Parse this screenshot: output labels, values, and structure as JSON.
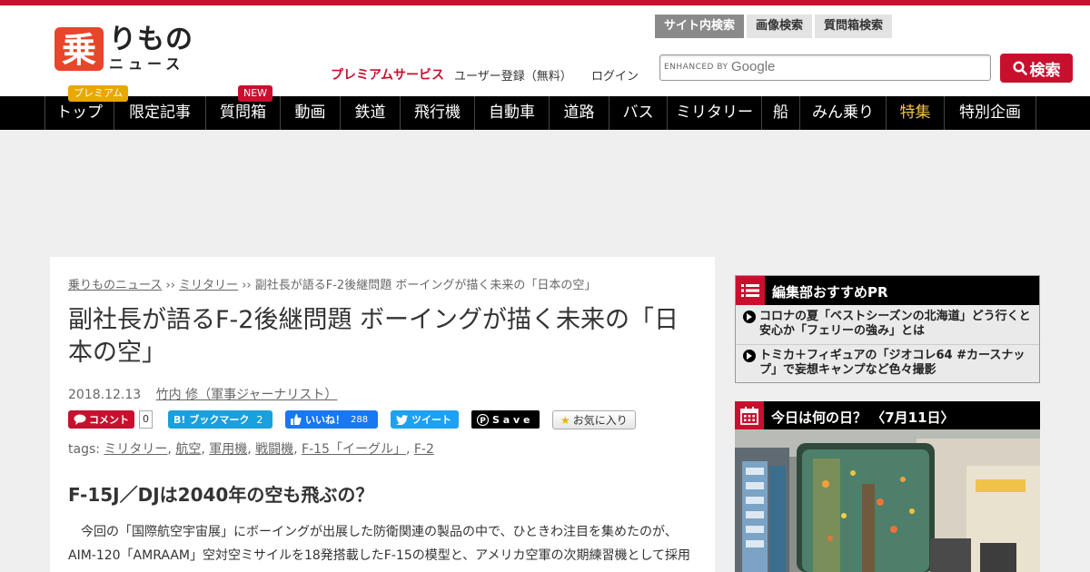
{
  "brand": {
    "colors": {
      "accent": "#c8102e",
      "nav_bg": "#000000",
      "premium_badge": "#e8a800",
      "page_bg": "#efefef"
    },
    "logo_kanji": "乗",
    "logo_kana": "りもの",
    "logo_sub": "ニュース"
  },
  "header": {
    "premium": "プレミアムサービス",
    "register": "ユーザー登録（無料）",
    "login": "ログイン",
    "search_tabs": [
      "サイト内検索",
      "画像検索",
      "質問箱検索"
    ],
    "search_placeholder_prefix": "ENHANCED BY",
    "search_placeholder_brand": "Google",
    "search_button": "検索",
    "search_icon": "magnifier-icon"
  },
  "nav": {
    "items": [
      "トップ",
      "限定記事",
      "質問箱",
      "動画",
      "鉄道",
      "飛行機",
      "自動車",
      "道路",
      "バス",
      "ミリタリー",
      "船",
      "みん乗り",
      "特集",
      "特別企画"
    ],
    "badge_premium": "プレミアム",
    "badge_new": "NEW"
  },
  "article": {
    "breadcrumb": [
      "乗りものニュース",
      "ミリタリー",
      "副社長が語るF-2後継問題 ボーイングが描く未来の「日本の空」"
    ],
    "breadcrumb_sep": "››",
    "title": "副社長が語るF-2後継問題 ボーイングが描く未来の「日本の空」",
    "date": "2018.12.13",
    "author": "竹内 修（軍事ジャーナリスト）",
    "share": {
      "comment_label": "コメント",
      "comment_count": "0",
      "hatena_label": "ブックマーク",
      "hatena_count": "2",
      "facebook_label": "いいね！",
      "facebook_count": "288",
      "twitter_label": "ツイート",
      "pinterest_label": "S a v e",
      "favorite_label": "お気に入り"
    },
    "tags_label": "tags:",
    "tags": [
      "ミリタリー",
      "航空",
      "軍用機",
      "戦闘機",
      "F-15「イーグル」",
      "F-2"
    ],
    "heading": "F-15J／DJは2040年の空も飛ぶの？",
    "body": "今回の「国際航空宇宙展」にボーイングが出展した防衛関連の製品の中で、ひときわ注目を集めたのが、AIM-120「AMRAAM」空対空ミサイルを18発搭載したF-15の模型と、アメリカ空軍の次期練習機として採用さ"
  },
  "sidebar": {
    "pr_title": "編集部おすすめPR",
    "pr_items": [
      "コロナの夏「ベストシーズンの北海道」どう行くと安心か「フェリーの強み」とは",
      "トミカ＋フィギュアの「ジオコレ64 #カースナップ」で妄想キャンプなど色々撮影"
    ],
    "today_title": "今日は何の日？ 〈7月11日〉"
  }
}
